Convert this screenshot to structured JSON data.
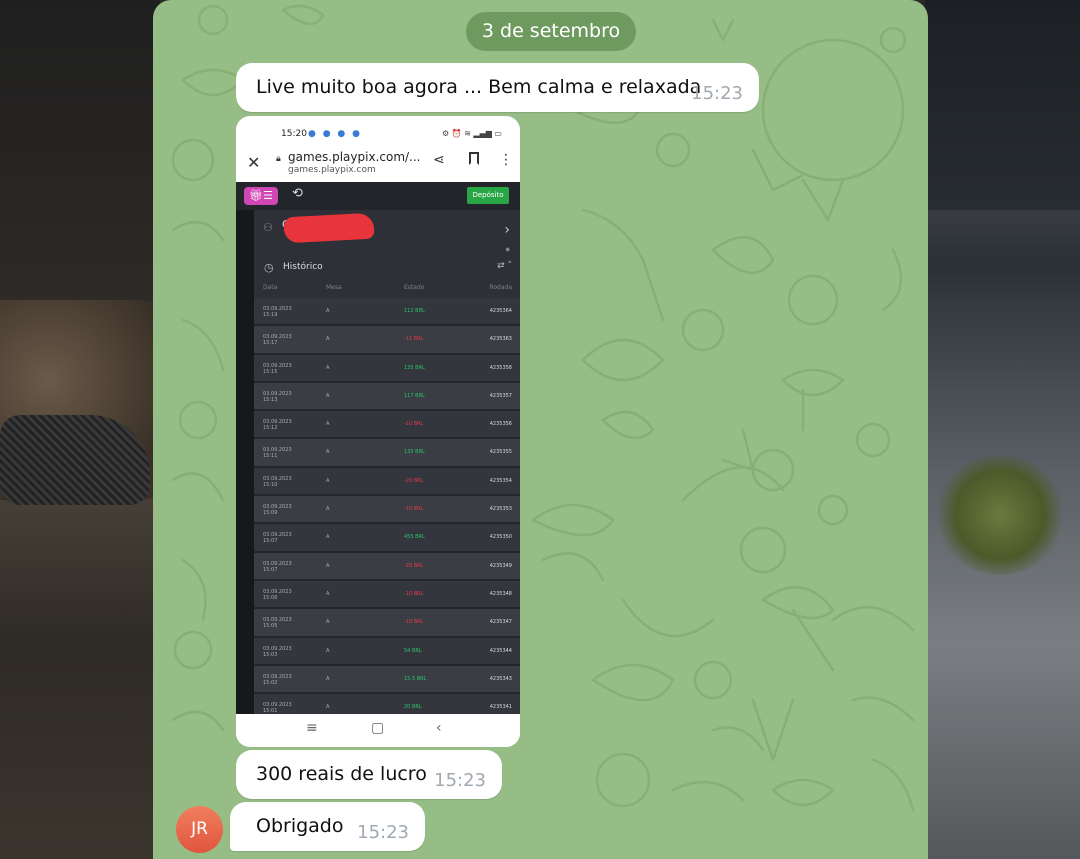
{
  "conversation": {
    "date_separator": "3 de setembro",
    "messages": [
      {
        "text": "Live muito boa agora ... Bem calma e relaxada",
        "time": "15:23"
      },
      {
        "text": "300 reais de lucro",
        "time": "15:23"
      },
      {
        "text": "Obrigado",
        "time": "15:23"
      }
    ],
    "avatar_initials": "JR"
  },
  "screenshot": {
    "status_time": "15:20",
    "url": "games.playpix.com/...",
    "url_sub": "games.playpix.com",
    "deposit_label": "Depósito",
    "user_initial": "C",
    "history_title": "Histórico",
    "columns": [
      "Data",
      "Mesa",
      "Estado",
      "Rodada"
    ],
    "rows": [
      {
        "date": "03.09.2023",
        "time": "15:19",
        "mesa": "A",
        "estado": "112 BRL",
        "status": "win",
        "rodada": "4235364"
      },
      {
        "date": "03.09.2023",
        "time": "15:17",
        "mesa": "A",
        "estado": "-11 BRL",
        "status": "loss",
        "rodada": "4235363"
      },
      {
        "date": "03.09.2023",
        "time": "15:15",
        "mesa": "A",
        "estado": "135 BRL",
        "status": "win",
        "rodada": "4235358"
      },
      {
        "date": "03.09.2023",
        "time": "15:13",
        "mesa": "A",
        "estado": "117 BRL",
        "status": "win",
        "rodada": "4235357"
      },
      {
        "date": "03.09.2023",
        "time": "15:12",
        "mesa": "A",
        "estado": "-10 BRL",
        "status": "loss",
        "rodada": "4235356"
      },
      {
        "date": "03.09.2023",
        "time": "15:11",
        "mesa": "A",
        "estado": "135 BRL",
        "status": "win",
        "rodada": "4235355"
      },
      {
        "date": "03.09.2023",
        "time": "15:10",
        "mesa": "A",
        "estado": "-20 BRL",
        "status": "loss",
        "rodada": "4235354"
      },
      {
        "date": "03.09.2023",
        "time": "15:09",
        "mesa": "A",
        "estado": "-10 BRL",
        "status": "loss",
        "rodada": "4235353"
      },
      {
        "date": "03.09.2023",
        "time": "15:07",
        "mesa": "A",
        "estado": "455 BRL",
        "status": "win",
        "rodada": "4235350"
      },
      {
        "date": "03.09.2023",
        "time": "15:07",
        "mesa": "A",
        "estado": "-20 BRL",
        "status": "loss",
        "rodada": "4235349"
      },
      {
        "date": "03.09.2023",
        "time": "15:06",
        "mesa": "A",
        "estado": "-10 BRL",
        "status": "loss",
        "rodada": "4235348"
      },
      {
        "date": "03.09.2023",
        "time": "15:05",
        "mesa": "A",
        "estado": "-10 BRL",
        "status": "loss",
        "rodada": "4235347"
      },
      {
        "date": "03.09.2023",
        "time": "15:03",
        "mesa": "A",
        "estado": "54 BRL",
        "status": "win",
        "rodada": "4235344"
      },
      {
        "date": "03.09.2023",
        "time": "15:02",
        "mesa": "A",
        "estado": "15.5 BRL",
        "status": "win",
        "rodada": "4235343"
      },
      {
        "date": "03.09.2023",
        "time": "15:01",
        "mesa": "A",
        "estado": "20 BRL",
        "status": "win",
        "rodada": "4235341"
      }
    ]
  },
  "colors": {
    "chat_background": "#97bd86",
    "date_pill": "#6f9a5f",
    "bubble": "#ffffff",
    "timestamp": "#a0a9b1",
    "win": "#2bc46b",
    "loss": "#e43a4f",
    "avatar": "#e86a4c"
  }
}
